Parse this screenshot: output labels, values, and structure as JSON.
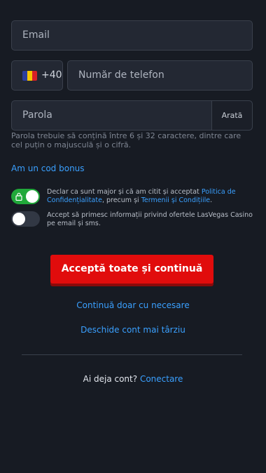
{
  "form": {
    "email_placeholder": "Email",
    "phone_prefix": "+40",
    "phone_placeholder": "Număr de telefon",
    "password_placeholder": "Parola",
    "show_label": "Arată",
    "password_hint": "Parola trebuie să conțină între 6 și 32 caractere, dintre care cel puțin o majusculă și o cifră."
  },
  "bonus": {
    "label": "Am un cod bonus"
  },
  "consent": {
    "terms_text_pre": "Declar ca sunt major și că am citit și acceptat ",
    "privacy_link": "Politica de Confidențialitate",
    "terms_mid": ", precum și ",
    "terms_link": "Termenii și Condițiile",
    "terms_end": ".",
    "marketing_text": "Accept să primesc informații privind ofertele LasVegas Casino pe email și sms.",
    "terms_accepted": true,
    "marketing_accepted": false
  },
  "actions": {
    "accept_all": "Acceptă toate și continuă",
    "continue_necessary": "Continuă doar cu necesare",
    "open_later": "Deschide cont mai târziu"
  },
  "account": {
    "question": "Ai deja cont?",
    "login_link": "Conectare"
  },
  "colors": {
    "background": "#171b23",
    "accent_red": "#e10c0c",
    "link_blue": "#3aa0ff",
    "toggle_on": "#21a83a"
  },
  "icons": {
    "flag": "romania-flag-icon",
    "lock": "lock-icon"
  }
}
